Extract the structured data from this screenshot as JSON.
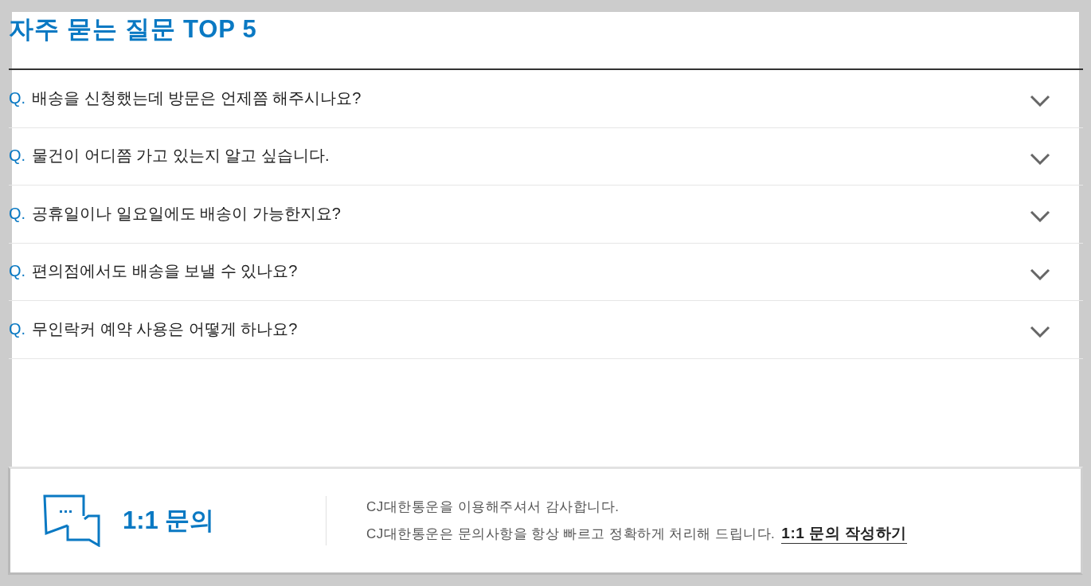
{
  "title": "자주 묻는 질문 TOP 5",
  "faq": [
    {
      "marker": "Q.",
      "question": "배송을 신청했는데 방문은 언제쯤 해주시나요?",
      "expanded": false
    },
    {
      "marker": "Q.",
      "question": "물건이 어디쯤 가고 있는지 알고 싶습니다.",
      "expanded": false
    },
    {
      "marker": "Q.",
      "question": "공휴일이나 일요일에도 배송이 가능한지요?",
      "expanded": false
    },
    {
      "marker": "Q.",
      "question": "편의점에서도 배송을 보낼 수 있나요?",
      "expanded": false
    },
    {
      "marker": "Q.",
      "question": "무인락커 예약 사용은 어떻게 하나요?",
      "expanded": false
    }
  ],
  "inquiry": {
    "title": "1:1 문의",
    "thanks": "CJ대한통운을 이용해주셔서 감사합니다.",
    "notice": "CJ대한통운은 문의사항을 항상 빠르고 정확하게 처리해 드립니다.",
    "link": "1:1 문의 작성하기"
  }
}
